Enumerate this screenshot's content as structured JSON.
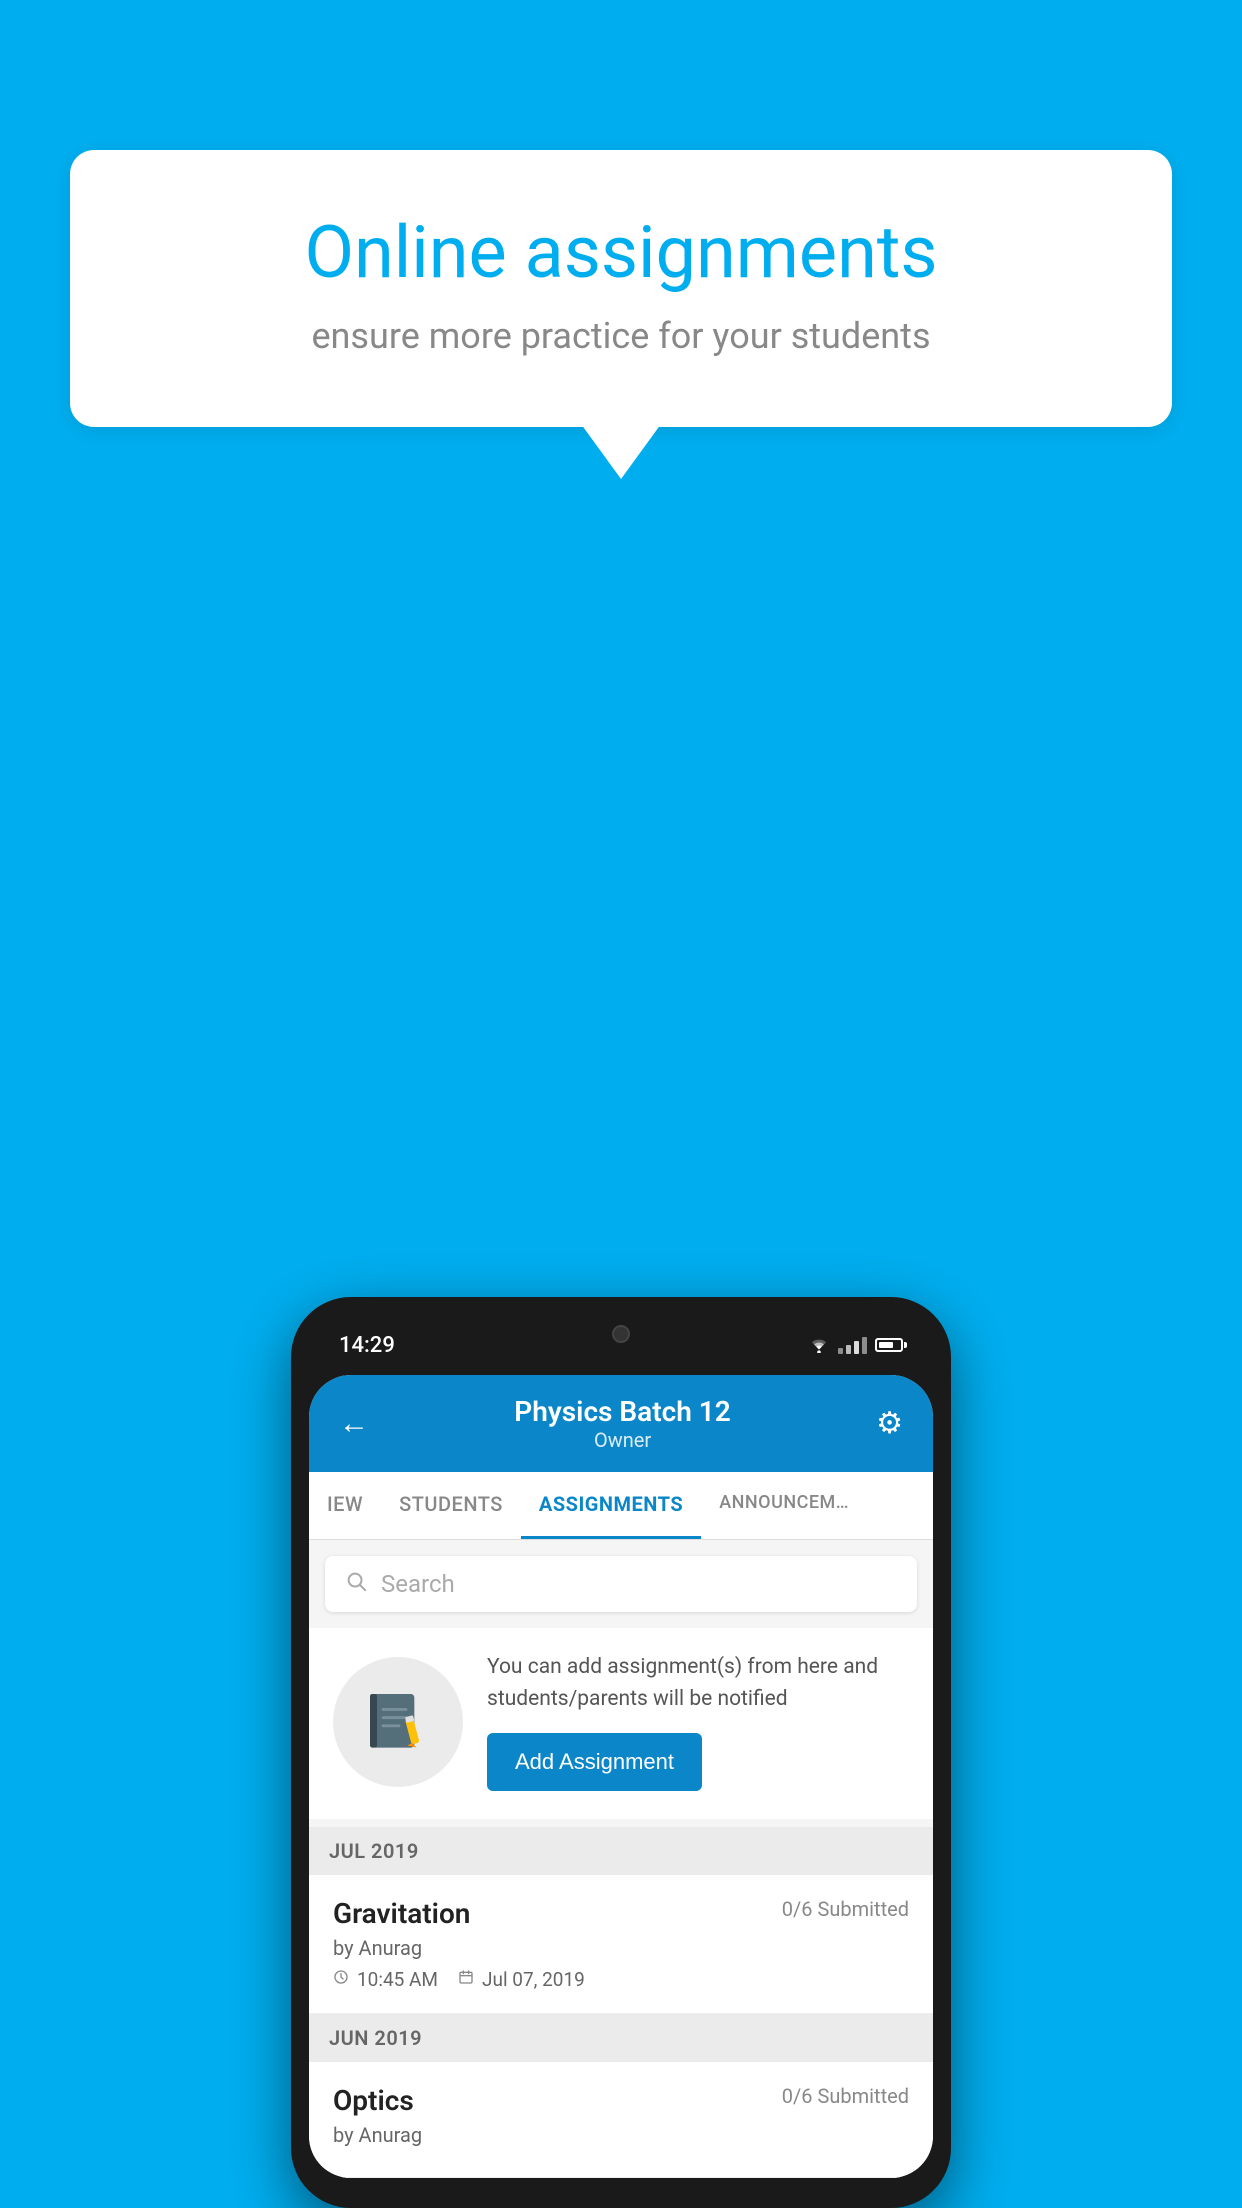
{
  "background_color": "#00AEEF",
  "speech_bubble": {
    "title": "Online assignments",
    "subtitle": "ensure more practice for your students"
  },
  "status_bar": {
    "time": "14:29"
  },
  "app_header": {
    "title": "Physics Batch 12",
    "subtitle": "Owner"
  },
  "tabs": [
    {
      "label": "IEW",
      "active": false
    },
    {
      "label": "STUDENTS",
      "active": false
    },
    {
      "label": "ASSIGNMENTS",
      "active": true
    },
    {
      "label": "ANNOUNCEM...",
      "active": false
    }
  ],
  "search": {
    "placeholder": "Search"
  },
  "info_card": {
    "description": "You can add assignment(s) from here and students/parents will be notified",
    "button_label": "Add Assignment"
  },
  "sections": [
    {
      "label": "JUL 2019",
      "assignments": [
        {
          "name": "Gravitation",
          "submitted": "0/6 Submitted",
          "by": "by Anurag",
          "time": "10:45 AM",
          "date": "Jul 07, 2019"
        }
      ]
    },
    {
      "label": "JUN 2019",
      "assignments": [
        {
          "name": "Optics",
          "submitted": "0/6 Submitted",
          "by": "by Anurag",
          "time": "",
          "date": ""
        }
      ]
    }
  ]
}
